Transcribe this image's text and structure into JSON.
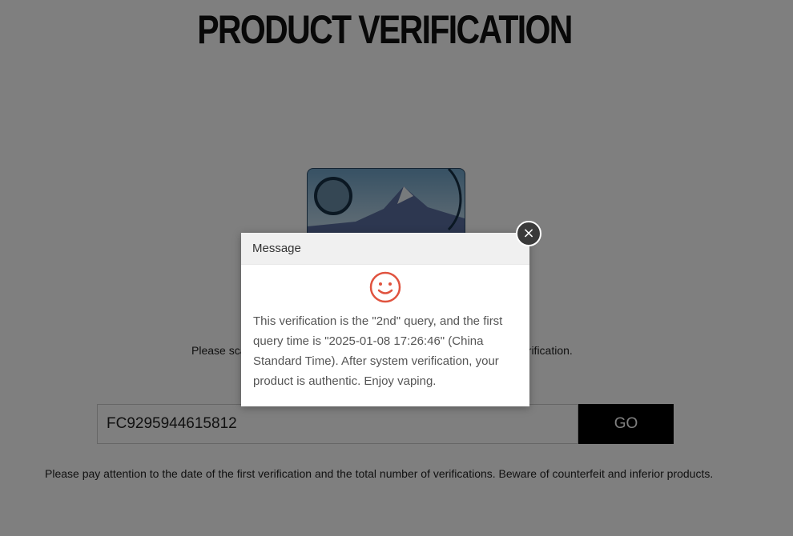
{
  "page": {
    "title": "PRODUCT VERIFICATION",
    "instruction_visible_start": "Please sca",
    "instruction_visible_end": "erification.",
    "verification_input_value": "FC9295944615812",
    "go_label": "GO",
    "warning": "Please pay attention to the date of the first verification and the total number of verifications. Beware of counterfeit and inferior products."
  },
  "modal": {
    "title": "Message",
    "icon": "smile-icon",
    "message": "This verification is the \"2nd\" query, and the first query time is \"2025-01-08 17:26:46\" (China Standard Time). After system verification, your product is authentic. Enjoy vaping.",
    "close_label": "×"
  },
  "colors": {
    "overlay": "#000000",
    "icon": "#e0533f",
    "button": "#000000"
  }
}
